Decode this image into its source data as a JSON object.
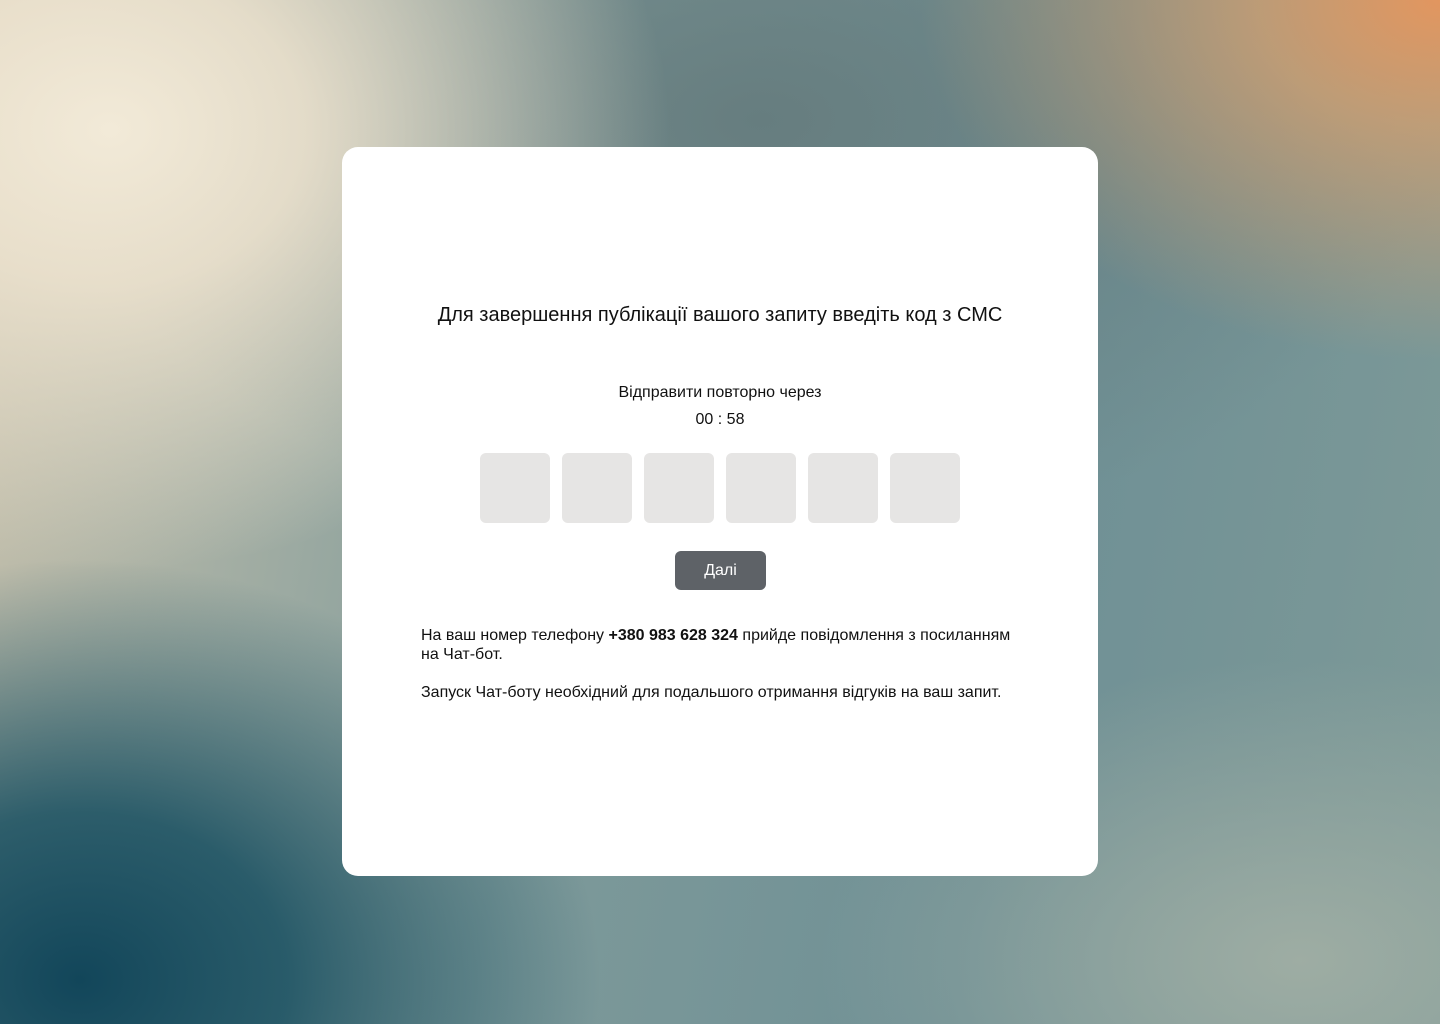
{
  "page": {
    "title": "Для завершення публікації вашого запиту введіть код з СМС",
    "resend_label": "Відправити повторно через",
    "timer": "00 : 58",
    "code_length": 6,
    "next_button": "Далі",
    "info_prefix": "На ваш номер телефону",
    "phone": "+380 983 628 324",
    "info_suffix": "прийде повідомлення з посиланням на Чат-бот.",
    "info_2": "Запуск Чат-боту необхідний для подальшого отримання відгуків на ваш запит."
  },
  "colors": {
    "card": "#ffffff",
    "code_box": "#e6e5e4",
    "button": "#5e6267",
    "button_text": "#ffffff"
  }
}
